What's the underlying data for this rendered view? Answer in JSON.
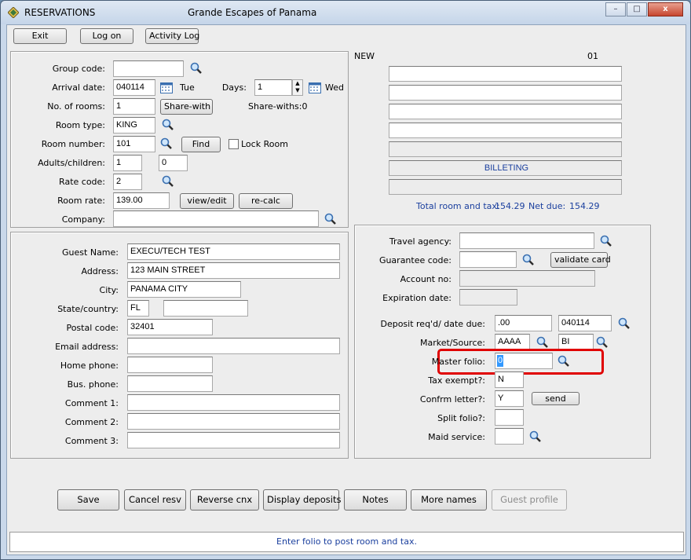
{
  "window": {
    "app_title": "RESERVATIONS",
    "hotel_name": "Grande Escapes of Panama",
    "min_label": "–",
    "max_label": "□",
    "close_label": "x"
  },
  "toolbar": {
    "exit": "Exit",
    "logon": "Log on",
    "activity_log": "Activity Log"
  },
  "room_panel": {
    "group_code_label": "Group code:",
    "group_code": "",
    "arrival_label": "Arrival date:",
    "arrival_date": "040114",
    "arrival_day": "Tue",
    "days_label": "Days:",
    "days": "1",
    "departure_day": "Wed",
    "rooms_label": "No. of rooms:",
    "rooms": "1",
    "share_with_btn": "Share-with",
    "share_withs": "Share-withs:0",
    "room_type_label": "Room type:",
    "room_type": "KING",
    "room_number_label": "Room number:",
    "room_number": "101",
    "find_btn": "Find",
    "lock_room": "Lock Room",
    "adults_label": "Adults/children:",
    "adults": "1",
    "children": "0",
    "rate_code_label": "Rate code:",
    "rate_code": "2",
    "room_rate_label": "Room rate:",
    "room_rate": "139.00",
    "view_edit_btn": "view/edit",
    "recalc_btn": "re-calc",
    "company_label": "Company:",
    "company": ""
  },
  "summary": {
    "status": "NEW",
    "folio_no": "01",
    "billeting": "BILLETING",
    "total_label": "Total room and tax:",
    "total": "154.29",
    "net_label": "Net due:",
    "net": "154.29"
  },
  "guest_panel": {
    "guest_name_label": "Guest Name:",
    "guest_name": "EXECU/TECH TEST",
    "address_label": "Address:",
    "address": "123 MAIN STREET",
    "city_label": "City:",
    "city": "PANAMA CITY",
    "state_label": "State/country:",
    "state": "FL",
    "country": "",
    "postal_label": "Postal code:",
    "postal": "32401",
    "email_label": "Email address:",
    "email": "",
    "home_phone_label": "Home phone:",
    "home_phone": "",
    "bus_phone_label": "Bus. phone:",
    "bus_phone": "",
    "comment1_label": "Comment 1:",
    "comment1": "",
    "comment2_label": "Comment 2:",
    "comment2": "",
    "comment3_label": "Comment 3:",
    "comment3": ""
  },
  "billing_panel": {
    "travel_agency_label": "Travel agency:",
    "travel_agency": "",
    "guarantee_label": "Guarantee code:",
    "guarantee": "",
    "validate_btn": "validate card",
    "account_label": "Account no:",
    "account": "",
    "expiration_label": "Expiration date:",
    "expiration": "",
    "deposit_label": "Deposit req'd/ date due:",
    "deposit": ".00",
    "deposit_date": "040114",
    "market_label": "Market/Source:",
    "market": "AAAA",
    "source": "BI",
    "master_folio_label": "Master folio:",
    "master_folio": "0",
    "tax_exempt_label": "Tax exempt?:",
    "tax_exempt": "N",
    "confirm_label": "Confrm letter?:",
    "confirm": "Y",
    "send_btn": "send",
    "split_label": "Split folio?:",
    "split": "",
    "maid_label": "Maid service:",
    "maid": ""
  },
  "actions": {
    "save": "Save",
    "cancel_resv": "Cancel resv",
    "reverse_cnx": "Reverse cnx",
    "display_deposits": "Display deposits",
    "notes": "Notes",
    "more_names": "More names",
    "guest_profile": "Guest profile"
  },
  "status_bar": "Enter folio to post room and tax.",
  "colors": {
    "highlight": "#e00000",
    "selection": "#3399ff",
    "status_text": "#1a3f9e"
  }
}
